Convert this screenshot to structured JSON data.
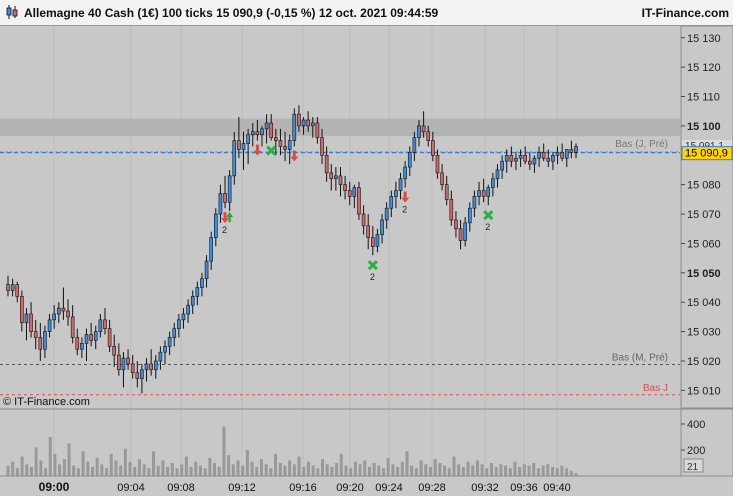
{
  "header": {
    "ticker_line": "Allemagne 40 Cash (1€) 100 ticks 15 090,9 (-0,15 %) 12 oct. 2021 09:44:59",
    "brand": "IT-Finance.com"
  },
  "colors": {
    "background": "#c8c8c8",
    "up_candle": "#3a8fe0",
    "down_candle": "#d46868",
    "wick": "#111111",
    "resistance_band": "#b4b4b4",
    "current_line": "#2f7fd8",
    "bas_mpre_line": "#555555",
    "bas_j_line": "#d05050",
    "volume_bar": "#999999",
    "buy_signal": "#2aa63a",
    "sell_signal": "#e04848",
    "exit_signal": "#2ab040"
  },
  "chart_data": [
    {
      "type": "candlestick",
      "title": "Allemagne 40 Cash (1€) 100 ticks",
      "ylim": [
        15004,
        15134
      ],
      "y_ticks": [
        "15 130",
        "15 120",
        "15 110",
        "15 100",
        "15 090",
        "15 080",
        "15 070",
        "15 060",
        "15 050",
        "15 040",
        "15 030",
        "15 020",
        "15 010"
      ],
      "y_tick_values": [
        15130,
        15120,
        15110,
        15100,
        15090,
        15080,
        15070,
        15060,
        15050,
        15040,
        15030,
        15020,
        15010
      ],
      "bold_ticks": [
        15100,
        15050
      ],
      "x_ticks": [
        "09:00",
        "09:04",
        "09:08",
        "09:12",
        "09:16",
        "09:20",
        "09:24",
        "09:28",
        "09:32",
        "09:36",
        "09:40"
      ],
      "last_price_label": "15 090,9",
      "last_price": 15090.9,
      "levels": [
        {
          "label": "15 091,1",
          "name": "Bas (J, Pré)",
          "value": 15091.1
        },
        {
          "label": "",
          "name": "Bas (M, Pré)",
          "value": 15018.8
        },
        {
          "label": "",
          "name": "Bas J",
          "value": 15008.5
        }
      ],
      "resistance_zone": [
        15096.5,
        15102.5
      ],
      "watermark": "© IT-Finance.com",
      "candles": [
        [
          15046,
          15049,
          15042,
          15044
        ],
        [
          15044,
          15048,
          15042,
          15046
        ],
        [
          15046,
          15047,
          15040,
          15042
        ],
        [
          15042,
          15044,
          15030,
          15033
        ],
        [
          15033,
          15038,
          15027,
          15036
        ],
        [
          15036,
          15040,
          15028,
          15030
        ],
        [
          15030,
          15034,
          15024,
          15028
        ],
        [
          15028,
          15033,
          15020,
          15024
        ],
        [
          15024,
          15032,
          15021,
          15030
        ],
        [
          15030,
          15036,
          15028,
          15034
        ],
        [
          15034,
          15039,
          15031,
          15036
        ],
        [
          15036,
          15040,
          15033,
          15038
        ],
        [
          15038,
          15045,
          15034,
          15037
        ],
        [
          15037,
          15041,
          15032,
          15035
        ],
        [
          15035,
          15039,
          15026,
          15028
        ],
        [
          15028,
          15031,
          15022,
          15024
        ],
        [
          15024,
          15028,
          15021,
          15026
        ],
        [
          15026,
          15031,
          15020,
          15029
        ],
        [
          15029,
          15033,
          15025,
          15027
        ],
        [
          15027,
          15032,
          15024,
          15030
        ],
        [
          15030,
          15036,
          15028,
          15034
        ],
        [
          15034,
          15038,
          15029,
          15031
        ],
        [
          15031,
          15034,
          15023,
          15025
        ],
        [
          15025,
          15029,
          15018,
          15022
        ],
        [
          15022,
          15026,
          15015,
          15017
        ],
        [
          15017,
          15023,
          15011,
          15021
        ],
        [
          15021,
          15024,
          15017,
          15019
        ],
        [
          15019,
          15022,
          15014,
          15016
        ],
        [
          15016,
          15020,
          15011,
          15014
        ],
        [
          15014,
          15019,
          15009,
          15017
        ],
        [
          15017,
          15021,
          15013,
          15019
        ],
        [
          15019,
          15024,
          15015,
          15017
        ],
        [
          15017,
          15022,
          15014,
          15020
        ],
        [
          15020,
          15025,
          15017,
          15023
        ],
        [
          15023,
          15027,
          15019,
          15025
        ],
        [
          15025,
          15030,
          15022,
          15028
        ],
        [
          15028,
          15033,
          15025,
          15031
        ],
        [
          15031,
          15036,
          15028,
          15034
        ],
        [
          15034,
          15038,
          15031,
          15036
        ],
        [
          15036,
          15041,
          15033,
          15039
        ],
        [
          15039,
          15044,
          15036,
          15042
        ],
        [
          15042,
          15047,
          15039,
          15045
        ],
        [
          15045,
          15050,
          15042,
          15048
        ],
        [
          15048,
          15056,
          15045,
          15054
        ],
        [
          15054,
          15064,
          15051,
          15062
        ],
        [
          15062,
          15072,
          15059,
          15070
        ],
        [
          15070,
          15080,
          15067,
          15077
        ],
        [
          15077,
          15083,
          15072,
          15074
        ],
        [
          15074,
          15085,
          15071,
          15083
        ],
        [
          15083,
          15098,
          15080,
          15095
        ],
        [
          15095,
          15103,
          15089,
          15092
        ],
        [
          15092,
          15098,
          15085,
          15094
        ],
        [
          15094,
          15099,
          15087,
          15097
        ],
        [
          15097,
          15101,
          15093,
          15098
        ],
        [
          15098,
          15102,
          15095,
          15097
        ],
        [
          15097,
          15100,
          15093,
          15099
        ],
        [
          15099,
          15104,
          15094,
          15101
        ],
        [
          15101,
          15104,
          15095,
          15096
        ],
        [
          15096,
          15099,
          15090,
          15095
        ],
        [
          15095,
          15099,
          15090,
          15093
        ],
        [
          15093,
          15098,
          15088,
          15092
        ],
        [
          15092,
          15097,
          15087,
          15095
        ],
        [
          15095,
          15106,
          15093,
          15104
        ],
        [
          15104,
          15107,
          15098,
          15100
        ],
        [
          15100,
          15103,
          15097,
          15102
        ],
        [
          15102,
          15105,
          15098,
          15100
        ],
        [
          15100,
          15103,
          15096,
          15101
        ],
        [
          15101,
          15103,
          15094,
          15096
        ],
        [
          15096,
          15099,
          15087,
          15090
        ],
        [
          15090,
          15093,
          15081,
          15084
        ],
        [
          15084,
          15087,
          15078,
          15082
        ],
        [
          15082,
          15086,
          15078,
          15083
        ],
        [
          15083,
          15086,
          15076,
          15080
        ],
        [
          15080,
          15083,
          15075,
          15078
        ],
        [
          15078,
          15081,
          15073,
          15076
        ],
        [
          15076,
          15080,
          15072,
          15079
        ],
        [
          15079,
          15081,
          15068,
          15070
        ],
        [
          15070,
          15073,
          15063,
          15066
        ],
        [
          15066,
          15070,
          15058,
          15062
        ],
        [
          15062,
          15066,
          15056,
          15059
        ],
        [
          15059,
          15065,
          15057,
          15063
        ],
        [
          15063,
          15070,
          15060,
          15068
        ],
        [
          15068,
          15074,
          15065,
          15072
        ],
        [
          15072,
          15078,
          15069,
          15076
        ],
        [
          15076,
          15081,
          15072,
          15078
        ],
        [
          15078,
          15084,
          15075,
          15082
        ],
        [
          15082,
          15088,
          15079,
          15086
        ],
        [
          15086,
          15093,
          15083,
          15091
        ],
        [
          15091,
          15098,
          15088,
          15096
        ],
        [
          15096,
          15102,
          15093,
          15100
        ],
        [
          15100,
          15105,
          15096,
          15098
        ],
        [
          15098,
          15100,
          15093,
          15095
        ],
        [
          15095,
          15098,
          15088,
          15090
        ],
        [
          15090,
          15092,
          15082,
          15084
        ],
        [
          15084,
          15087,
          15078,
          15080
        ],
        [
          15080,
          15083,
          15073,
          15075
        ],
        [
          15075,
          15078,
          15066,
          15068
        ],
        [
          15068,
          15071,
          15062,
          15065
        ],
        [
          15065,
          15068,
          15058,
          15061
        ],
        [
          15061,
          15069,
          15059,
          15067
        ],
        [
          15067,
          15074,
          15064,
          15072
        ],
        [
          15072,
          15078,
          15069,
          15076
        ],
        [
          15076,
          15081,
          15073,
          15078
        ],
        [
          15078,
          15082,
          15074,
          15076
        ],
        [
          15076,
          15080,
          15073,
          15079
        ],
        [
          15079,
          15084,
          15076,
          15082
        ],
        [
          15082,
          15087,
          15079,
          15085
        ],
        [
          15085,
          15090,
          15082,
          15088
        ],
        [
          15088,
          15092,
          15084,
          15090
        ],
        [
          15090,
          15093,
          15086,
          15088
        ],
        [
          15088,
          15091,
          15085,
          15089
        ],
        [
          15089,
          15092,
          15086,
          15090
        ],
        [
          15090,
          15093,
          15087,
          15088
        ],
        [
          15088,
          15091,
          15085,
          15087
        ],
        [
          15087,
          15090,
          15084,
          15089
        ],
        [
          15089,
          15093,
          15086,
          15091
        ],
        [
          15091,
          15094,
          15088,
          15089
        ],
        [
          15089,
          15092,
          15086,
          15088
        ],
        [
          15088,
          15091,
          15085,
          15090
        ],
        [
          15090,
          15093,
          15087,
          15091
        ],
        [
          15091,
          15094,
          15088,
          15089
        ],
        [
          15089,
          15092,
          15086,
          15092
        ],
        [
          15092,
          15095,
          15089,
          15091
        ],
        [
          15091,
          15094,
          15089,
          15093
        ]
      ],
      "signals": [
        {
          "candle": 47,
          "kind": "sell-arrow",
          "label": "2"
        },
        {
          "candle": 48,
          "kind": "buy-arrow",
          "label": ""
        },
        {
          "candle": 54,
          "kind": "sell-arrow",
          "label": ""
        },
        {
          "candle": 57,
          "kind": "exit-cross",
          "label": ""
        },
        {
          "candle": 62,
          "kind": "sell-arrow",
          "label": ""
        },
        {
          "candle": 79,
          "kind": "exit-cross",
          "label": "2"
        },
        {
          "candle": 86,
          "kind": "sell-arrow",
          "label": "2"
        },
        {
          "candle": 104,
          "kind": "exit-cross",
          "label": "2"
        }
      ]
    },
    {
      "type": "bar",
      "title": "Volume",
      "ylim": [
        0,
        500
      ],
      "y_ticks": [
        "400",
        "200"
      ],
      "y_tick_values": [
        400,
        200
      ],
      "last_value_label": "21",
      "last_value": 21,
      "values": [
        80,
        110,
        60,
        150,
        90,
        70,
        220,
        120,
        60,
        300,
        170,
        90,
        130,
        250,
        80,
        60,
        190,
        110,
        70,
        140,
        90,
        60,
        170,
        120,
        80,
        210,
        110,
        70,
        130,
        90,
        60,
        190,
        80,
        120,
        70,
        100,
        60,
        90,
        150,
        70,
        110,
        80,
        60,
        140,
        100,
        70,
        380,
        160,
        90,
        120,
        80,
        200,
        110,
        70,
        130,
        90,
        60,
        170,
        100,
        80,
        120,
        90,
        150,
        70,
        110,
        80,
        60,
        130,
        90,
        70,
        100,
        170,
        80,
        60,
        110,
        90,
        120,
        70,
        100,
        80,
        60,
        140,
        90,
        70,
        110,
        190,
        80,
        60,
        120,
        90,
        70,
        130,
        100,
        80,
        60,
        150,
        90,
        70,
        110,
        80,
        120,
        90,
        60,
        100,
        70,
        90,
        80,
        60,
        110,
        70,
        90,
        80,
        100,
        60,
        80,
        90,
        70,
        60,
        80,
        60,
        40,
        21
      ]
    }
  ]
}
